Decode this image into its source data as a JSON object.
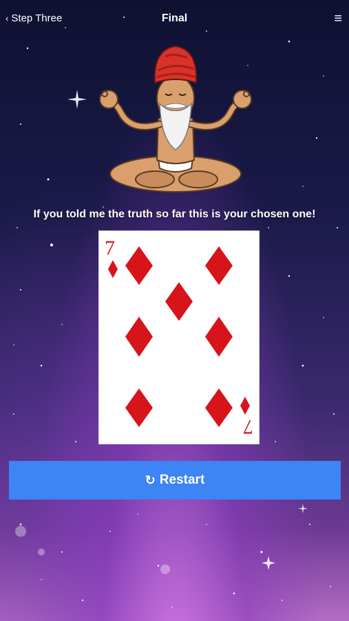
{
  "navbar": {
    "back_label": "Step Three",
    "title": "Final",
    "menu_icon": "≡"
  },
  "message": "If you told me the truth so far this is your chosen one!",
  "card": {
    "rank": "7",
    "suit": "diamonds",
    "suit_color": "#d7141a"
  },
  "restart": {
    "label": "Restart",
    "icon": "↻"
  },
  "colors": {
    "accent": "#3d84f5",
    "turban": "#d8322a"
  }
}
